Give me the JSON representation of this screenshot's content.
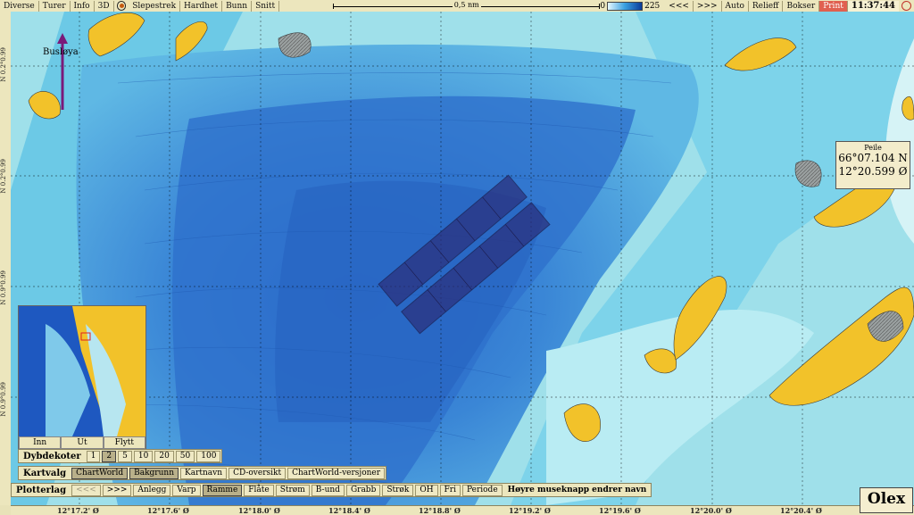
{
  "topbar": {
    "menus": [
      "Diverse",
      "Turer",
      "Info",
      "3D"
    ],
    "menus2": [
      "Slepestrek",
      "Hardhet",
      "Bunn",
      "Snitt"
    ],
    "scale_label": "0,5 nm",
    "depth_min": "0",
    "depth_max": "225",
    "nav_prev": "<<<",
    "nav_next": ">>>",
    "auto": "Auto",
    "relieff": "Relieff",
    "bokser": "Bokser",
    "print": "Print",
    "clock": "11:37:44"
  },
  "map": {
    "place_name": "Busløya",
    "lat_labels": [
      "N 0.2°0.99",
      "N 0.2°0.99",
      "N 0.9°0.99",
      "N 0.9°0.99"
    ],
    "lon_labels": [
      "12°17.2' Ø",
      "12°17.6' Ø",
      "12°18.0' Ø",
      "12°18.4' Ø",
      "12°18.8' Ø",
      "12°19.2' Ø",
      "12°19.6' Ø",
      "12°20.0' Ø",
      "12°20.4' Ø"
    ]
  },
  "peile": {
    "title": "Peile",
    "lat": "66°07.104 N",
    "lon": "12°20.599 Ø"
  },
  "minimap": {
    "buttons": [
      "Inn",
      "Ut",
      "Flytt"
    ]
  },
  "dybdekoter": {
    "title": "Dybdekoter",
    "values": [
      "1",
      "2",
      "5",
      "10",
      "20",
      "50",
      "100"
    ],
    "selected": "2"
  },
  "kartvalg": {
    "title": "Kartvalg",
    "buttons": [
      "ChartWorld",
      "Bakgrunn",
      "Kartnavn",
      "CD-oversikt",
      "ChartWorld-versjoner"
    ]
  },
  "plotterlag": {
    "title": "Plotterlag",
    "buttons": [
      "<<<",
      ">>>",
      "Anlegg",
      "Varp",
      "Ramme",
      "Flåte",
      "Strøm",
      "B-und",
      "Grabb",
      "Strøk",
      "OH",
      "Fri",
      "Periode"
    ],
    "hint": "Høyre museknapp endrer navn"
  },
  "logo": "Olex"
}
